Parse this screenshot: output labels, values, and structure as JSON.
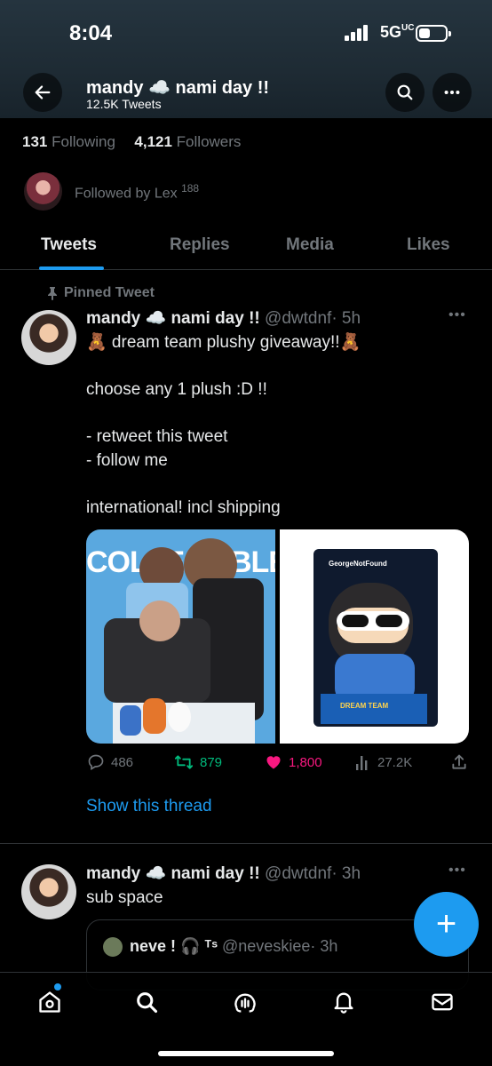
{
  "status_bar": {
    "time": "8:04",
    "network": "5G",
    "network_sup": "UC"
  },
  "header": {
    "name": "mandy ☁️ nami day !!",
    "tweet_count": "12.5K Tweets"
  },
  "profile": {
    "following_count": "131",
    "following_label": "Following",
    "followers_count": "4,121",
    "followers_label": "Followers",
    "followed_by": "Followed by Lex",
    "followed_by_extra": "188"
  },
  "tabs": [
    {
      "label": "Tweets",
      "active": true
    },
    {
      "label": "Replies",
      "active": false
    },
    {
      "label": "Media",
      "active": false
    },
    {
      "label": "Likes",
      "active": false
    }
  ],
  "tweets": [
    {
      "pinned_label": "Pinned Tweet",
      "name": "mandy ☁️ nami day !!",
      "handle": "@dwtdnf",
      "time": "· 5h",
      "text": "🧸 dream team plushy giveaway!!🧸\n\nchoose any 1 plush :D !!\n\n- retweet this tweet\n- follow me\n\ninternational! incl shipping",
      "media_text": {
        "left_banner": "COLLECTIBLE",
        "right_brand": "GeorgeNotFound",
        "right_box": "DREAM TEAM"
      },
      "replies": "486",
      "retweets": "879",
      "likes": "1,800",
      "views": "27.2K",
      "thread_link": "Show this thread"
    },
    {
      "name": "mandy ☁️ nami day !!",
      "handle": "@dwtdnf",
      "time": "· 3h",
      "text": "sub space",
      "quote": {
        "name": "neve ! 🎧 ᵀˢ",
        "handle": "@neveskiee",
        "time": "· 3h"
      }
    }
  ],
  "fab_label": "+",
  "colors": {
    "accent": "#1d9bf0",
    "retweet": "#00ba7c",
    "like": "#f91880",
    "muted": "#71767b"
  }
}
